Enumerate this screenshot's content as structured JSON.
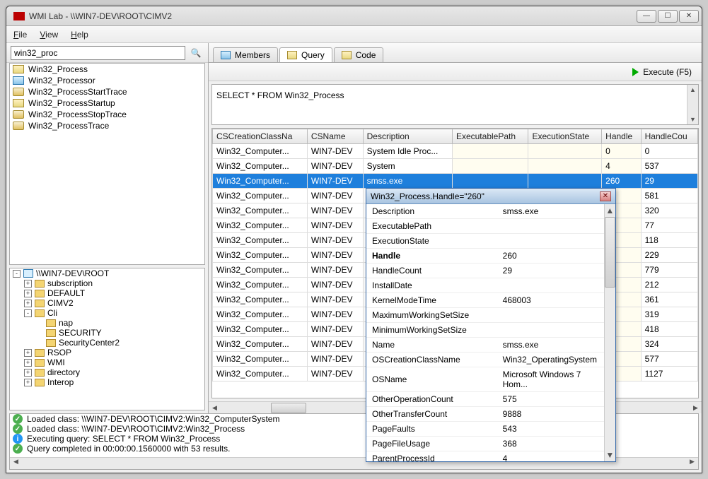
{
  "titlebar": {
    "title": "WMI Lab - \\\\WIN7-DEV\\ROOT\\CIMV2"
  },
  "menu": {
    "file": "File",
    "view": "View",
    "help": "Help"
  },
  "search": {
    "value": "win32_proc"
  },
  "class_items": [
    {
      "icon": "yellow",
      "label": "Win32_Process"
    },
    {
      "icon": "blue",
      "label": "Win32_Processor"
    },
    {
      "icon": "wrench",
      "label": "Win32_ProcessStartTrace"
    },
    {
      "icon": "yellow",
      "label": "Win32_ProcessStartup"
    },
    {
      "icon": "wrench",
      "label": "Win32_ProcessStopTrace"
    },
    {
      "icon": "wrench",
      "label": "Win32_ProcessTrace"
    }
  ],
  "tree": {
    "root": "\\\\WIN7-DEV\\ROOT",
    "nodes": [
      {
        "label": "subscription"
      },
      {
        "label": "DEFAULT"
      },
      {
        "label": "CIMV2"
      },
      {
        "label": "Cli",
        "expanded": true,
        "children": [
          {
            "label": "nap"
          },
          {
            "label": "SECURITY"
          },
          {
            "label": "SecurityCenter2"
          }
        ]
      },
      {
        "label": "RSOP"
      },
      {
        "label": "WMI"
      },
      {
        "label": "directory"
      },
      {
        "label": "Interop"
      }
    ]
  },
  "tabs": {
    "members": "Members",
    "query": "Query",
    "code": "Code"
  },
  "execute": "Execute (F5)",
  "query_text": "SELECT * FROM Win32_Process",
  "grid_headers": [
    "CSCreationClassName",
    "CSName",
    "Description",
    "ExecutablePath",
    "ExecutionState",
    "Handle",
    "HandleCount"
  ],
  "grid_header_display": [
    "CSCreationClassNa",
    "CSName",
    "Description",
    "ExecutablePath",
    "ExecutionState",
    "Handle",
    "HandleCou"
  ],
  "grid_rows": [
    {
      "cs": "Win32_Computer...",
      "csn": "WIN7-DEV",
      "desc": "System Idle Proc...",
      "ep": "",
      "es": "",
      "h": "0",
      "hc": "0"
    },
    {
      "cs": "Win32_Computer...",
      "csn": "WIN7-DEV",
      "desc": "System",
      "ep": "",
      "es": "",
      "h": "4",
      "hc": "537"
    },
    {
      "cs": "Win32_Computer...",
      "csn": "WIN7-DEV",
      "desc": "smss.exe",
      "ep": "",
      "es": "",
      "h": "260",
      "hc": "29",
      "sel": true
    },
    {
      "cs": "Win32_Computer...",
      "csn": "WIN7-DEV",
      "desc": "",
      "ep": "",
      "es": "",
      "h": "",
      "hc": "581"
    },
    {
      "cs": "Win32_Computer...",
      "csn": "WIN7-DEV",
      "desc": "",
      "ep": "",
      "es": "",
      "h": "",
      "hc": "320"
    },
    {
      "cs": "Win32_Computer...",
      "csn": "WIN7-DEV",
      "desc": "",
      "ep": "",
      "es": "",
      "h": "",
      "hc": "77"
    },
    {
      "cs": "Win32_Computer...",
      "csn": "WIN7-DEV",
      "desc": "",
      "ep": "",
      "es": "",
      "h": "",
      "hc": "118"
    },
    {
      "cs": "Win32_Computer...",
      "csn": "WIN7-DEV",
      "desc": "",
      "ep": "",
      "es": "",
      "h": "",
      "hc": "229"
    },
    {
      "cs": "Win32_Computer...",
      "csn": "WIN7-DEV",
      "desc": "",
      "ep": "",
      "es": "",
      "h": "",
      "hc": "779"
    },
    {
      "cs": "Win32_Computer...",
      "csn": "WIN7-DEV",
      "desc": "",
      "ep": "",
      "es": "",
      "h": "",
      "hc": "212"
    },
    {
      "cs": "Win32_Computer...",
      "csn": "WIN7-DEV",
      "desc": "",
      "ep": "",
      "es": "",
      "h": "",
      "hc": "361"
    },
    {
      "cs": "Win32_Computer...",
      "csn": "WIN7-DEV",
      "desc": "",
      "ep": "",
      "es": "",
      "h": "",
      "hc": "319"
    },
    {
      "cs": "Win32_Computer...",
      "csn": "WIN7-DEV",
      "desc": "",
      "ep": "",
      "es": "",
      "h": "",
      "hc": "418"
    },
    {
      "cs": "Win32_Computer...",
      "csn": "WIN7-DEV",
      "desc": "",
      "ep": "",
      "es": "",
      "h": "",
      "hc": "324"
    },
    {
      "cs": "Win32_Computer...",
      "csn": "WIN7-DEV",
      "desc": "",
      "ep": "",
      "es": "",
      "h": "",
      "hc": "577"
    },
    {
      "cs": "Win32_Computer...",
      "csn": "WIN7-DEV",
      "desc": "",
      "ep": "",
      "es": "",
      "h": "",
      "hc": "1127"
    }
  ],
  "popup": {
    "title": "Win32_Process.Handle=\"260\"",
    "rows": [
      {
        "k": "Description",
        "v": "smss.exe"
      },
      {
        "k": "ExecutablePath",
        "v": ""
      },
      {
        "k": "ExecutionState",
        "v": ""
      },
      {
        "k": "Handle",
        "v": "260",
        "bold": true
      },
      {
        "k": "HandleCount",
        "v": "29"
      },
      {
        "k": "InstallDate",
        "v": ""
      },
      {
        "k": "KernelModeTime",
        "v": "468003"
      },
      {
        "k": "MaximumWorkingSetSize",
        "v": ""
      },
      {
        "k": "MinimumWorkingSetSize",
        "v": ""
      },
      {
        "k": "Name",
        "v": "smss.exe"
      },
      {
        "k": "OSCreationClassName",
        "v": "Win32_OperatingSystem"
      },
      {
        "k": "OSName",
        "v": "Microsoft Windows 7 Hom..."
      },
      {
        "k": "OtherOperationCount",
        "v": "575"
      },
      {
        "k": "OtherTransferCount",
        "v": "9888"
      },
      {
        "k": "PageFaults",
        "v": "543"
      },
      {
        "k": "PageFileUsage",
        "v": "368"
      },
      {
        "k": "ParentProcessId",
        "v": "4"
      }
    ]
  },
  "log": [
    {
      "type": "ok",
      "text": "Loaded class: \\\\WIN7-DEV\\ROOT\\CIMV2:Win32_ComputerSystem"
    },
    {
      "type": "ok",
      "text": "Loaded class: \\\\WIN7-DEV\\ROOT\\CIMV2:Win32_Process"
    },
    {
      "type": "info",
      "text": "Executing query: SELECT * FROM Win32_Process"
    },
    {
      "type": "ok",
      "text": "Query completed in 00:00:00.1560000 with 53 results."
    }
  ]
}
